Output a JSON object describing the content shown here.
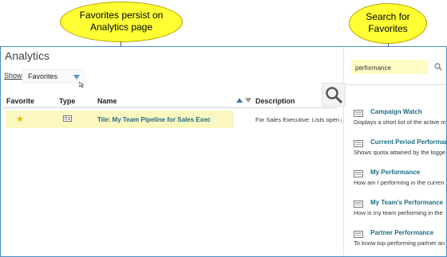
{
  "page": {
    "title": "Analytics",
    "show_label": "Show",
    "show_value": "Favorites"
  },
  "table": {
    "columns": [
      "Favorite",
      "Type",
      "Name",
      "Description"
    ],
    "rows": [
      {
        "favorite": true,
        "type_icon": "dashboard-tile-icon",
        "name": "Tile: My Team Pipeline for Sales Exec",
        "description": "For Sales Executive: Lists open p"
      }
    ]
  },
  "search": {
    "value": "performance",
    "results": [
      {
        "icon": "report-icon",
        "title": "Campaign Watch",
        "desc": "Displays a short list of the active m"
      },
      {
        "icon": "report-icon",
        "title": "Current Period Performance",
        "desc": "Shows quota attained by the logge"
      },
      {
        "icon": "report-icon",
        "title": "My Performance",
        "desc": "How am I performing in the curren"
      },
      {
        "icon": "report-icon",
        "title": "My Team's Performance",
        "desc": "How is my team performing in the"
      },
      {
        "icon": "report-icon",
        "title": "Partner Performance",
        "desc": "To know top performing partner an"
      }
    ]
  },
  "callouts": {
    "left_line1": "Favorites persist on",
    "left_line2": "Analytics page",
    "right_line1": "Search for",
    "right_line2": "Favorites"
  },
  "colors": {
    "accent": "#4a8fc4",
    "link": "#1f6d84",
    "highlight_row": "#fbf7c0",
    "callout": "#ffff33",
    "star": "#f0b400"
  }
}
